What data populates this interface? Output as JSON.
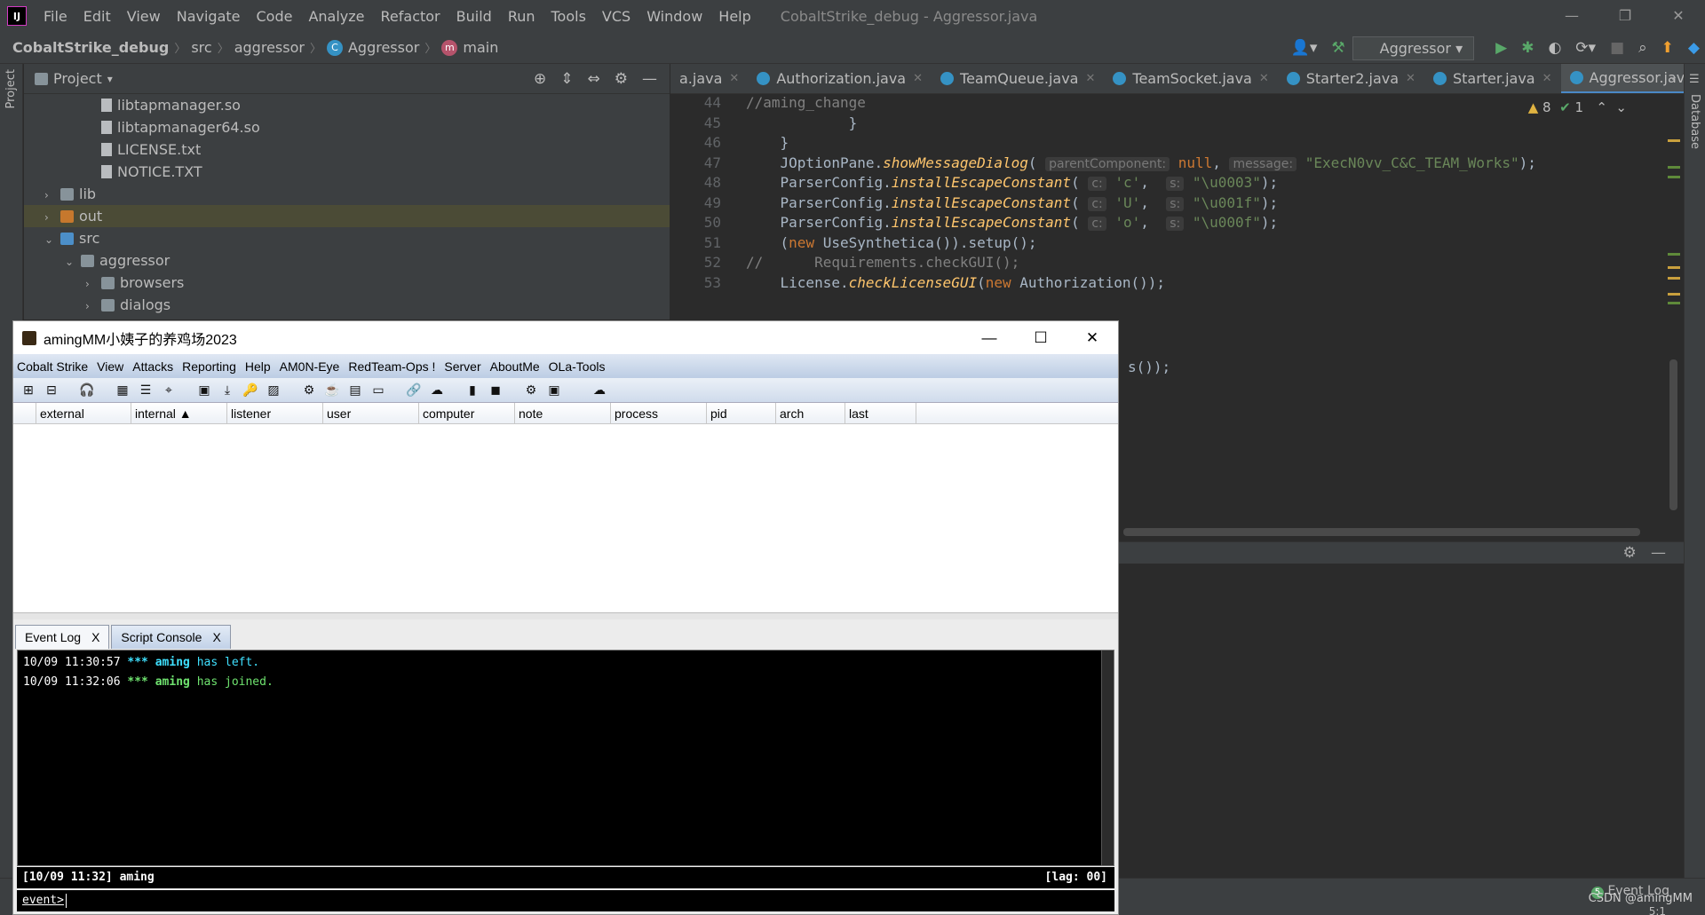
{
  "ide": {
    "menu": [
      "File",
      "Edit",
      "View",
      "Navigate",
      "Code",
      "Analyze",
      "Refactor",
      "Build",
      "Run",
      "Tools",
      "VCS",
      "Window",
      "Help"
    ],
    "window_title": "CobaltStrike_debug - Aggressor.java",
    "breadcrumb": [
      "CobaltStrike_debug",
      "src",
      "aggressor",
      "Aggressor",
      "main"
    ],
    "run_config": "Aggressor",
    "left_stripe": [
      "Project"
    ],
    "right_stripe": [
      "Database"
    ],
    "project_panel": {
      "title": "Project",
      "items": [
        {
          "label": "libtapmanager.so",
          "type": "file",
          "indent": 3
        },
        {
          "label": "libtapmanager64.so",
          "type": "file",
          "indent": 3
        },
        {
          "label": "LICENSE.txt",
          "type": "file",
          "indent": 3
        },
        {
          "label": "NOTICE.TXT",
          "type": "file",
          "indent": 3
        },
        {
          "label": "lib",
          "type": "folder",
          "indent": 1,
          "arrow": "›"
        },
        {
          "label": "out",
          "type": "folder-orange",
          "indent": 1,
          "arrow": "›",
          "selected": true
        },
        {
          "label": "src",
          "type": "folder-blue",
          "indent": 1,
          "arrow": "⌄"
        },
        {
          "label": "aggressor",
          "type": "folder",
          "indent": 2,
          "arrow": "⌄"
        },
        {
          "label": "browsers",
          "type": "folder",
          "indent": 3,
          "arrow": "›"
        },
        {
          "label": "dialogs",
          "type": "folder",
          "indent": 3,
          "arrow": "›"
        }
      ]
    },
    "tabs": [
      {
        "label": "a.java",
        "active": false
      },
      {
        "label": "Authorization.java",
        "active": false
      },
      {
        "label": "TeamQueue.java",
        "active": false
      },
      {
        "label": "TeamSocket.java",
        "active": false
      },
      {
        "label": "Starter2.java",
        "active": false
      },
      {
        "label": "Starter.java",
        "active": false
      },
      {
        "label": "Aggressor.java",
        "active": true
      }
    ],
    "inspection": {
      "warnings": "8",
      "ok": "1"
    },
    "line_numbers": [
      "44",
      "45",
      "46",
      "47",
      "48",
      "49",
      "50",
      "51",
      "52",
      "53"
    ],
    "code_lines": [
      [
        {
          "c": "cm",
          "t": "//aming_change"
        }
      ],
      [
        {
          "t": "            }"
        }
      ],
      [
        {
          "t": "    }"
        }
      ],
      [
        {
          "t": "    JOptionPane."
        },
        {
          "c": "mth",
          "t": "showMessageDialog"
        },
        {
          "t": "( "
        },
        {
          "c": "hint",
          "t": "parentComponent:"
        },
        {
          "t": " "
        },
        {
          "c": "kw",
          "t": "null"
        },
        {
          "t": ", "
        },
        {
          "c": "hint",
          "t": "message:"
        },
        {
          "t": " "
        },
        {
          "c": "str",
          "t": "\"ExecN0vv_C&C_TEAM_Works\""
        },
        {
          "t": ");"
        }
      ],
      [
        {
          "t": "    ParserConfig."
        },
        {
          "c": "mth",
          "t": "installEscapeConstant"
        },
        {
          "t": "( "
        },
        {
          "c": "hint",
          "t": "c:"
        },
        {
          "t": " "
        },
        {
          "c": "str",
          "t": "'c'"
        },
        {
          "t": ",  "
        },
        {
          "c": "hint",
          "t": "s:"
        },
        {
          "t": " "
        },
        {
          "c": "str",
          "t": "\"\\u0003\""
        },
        {
          "t": ");"
        }
      ],
      [
        {
          "t": "    ParserConfig."
        },
        {
          "c": "mth",
          "t": "installEscapeConstant"
        },
        {
          "t": "( "
        },
        {
          "c": "hint",
          "t": "c:"
        },
        {
          "t": " "
        },
        {
          "c": "str",
          "t": "'U'"
        },
        {
          "t": ",  "
        },
        {
          "c": "hint",
          "t": "s:"
        },
        {
          "t": " "
        },
        {
          "c": "str",
          "t": "\"\\u001f\""
        },
        {
          "t": ");"
        }
      ],
      [
        {
          "t": "    ParserConfig."
        },
        {
          "c": "mth",
          "t": "installEscapeConstant"
        },
        {
          "t": "( "
        },
        {
          "c": "hint",
          "t": "c:"
        },
        {
          "t": " "
        },
        {
          "c": "str",
          "t": "'o'"
        },
        {
          "t": ",  "
        },
        {
          "c": "hint",
          "t": "s:"
        },
        {
          "t": " "
        },
        {
          "c": "str",
          "t": "\"\\u000f\""
        },
        {
          "t": ");"
        }
      ],
      [
        {
          "t": "    ("
        },
        {
          "c": "kw",
          "t": "new"
        },
        {
          "t": " UseSynthetica()).setup();"
        }
      ],
      [
        {
          "c": "cm",
          "t": "//      Requirements.checkGUI();"
        }
      ],
      [
        {
          "t": "    License."
        },
        {
          "c": "mth",
          "t": "checkLicenseGUI"
        },
        {
          "t": "("
        },
        {
          "c": "kw",
          "t": "new"
        },
        {
          "t": " Authorization());"
        }
      ]
    ],
    "code_tail": "s());",
    "status": {
      "event_log": "Event Log",
      "position": "5:1"
    },
    "watermark": "CSDN @amingMM"
  },
  "cs": {
    "title": "amingMM小姨子的养鸡场2023",
    "menu": [
      "Cobalt Strike",
      "View",
      "Attacks",
      "Reporting",
      "Help",
      "AM0N-Eye",
      "RedTeam-Ops !",
      "Server",
      "AboutMe",
      "OLa-Tools"
    ],
    "columns": [
      {
        "label": "",
        "w": 26
      },
      {
        "label": "external",
        "w": 107
      },
      {
        "label": "internal ▲",
        "w": 108
      },
      {
        "label": "listener",
        "w": 108
      },
      {
        "label": "user",
        "w": 108
      },
      {
        "label": "computer",
        "w": 108
      },
      {
        "label": "note",
        "w": 108
      },
      {
        "label": "process",
        "w": 108
      },
      {
        "label": "pid",
        "w": 78
      },
      {
        "label": "arch",
        "w": 78
      },
      {
        "label": "last",
        "w": 80
      }
    ],
    "bottom_tabs": [
      {
        "label": "Event Log",
        "active": true
      },
      {
        "label": "Script Console",
        "active": false
      }
    ],
    "log": [
      {
        "time": "10/09 11:30:57",
        "stars": "***",
        "user": "aming",
        "msg": "has left."
      },
      {
        "time": "10/09 11:32:06",
        "stars": "***",
        "user": "aming",
        "msg": "has joined."
      }
    ],
    "status_left": "[10/09 11:32] aming",
    "status_right": "[lag: 00]",
    "prompt": "event>"
  }
}
